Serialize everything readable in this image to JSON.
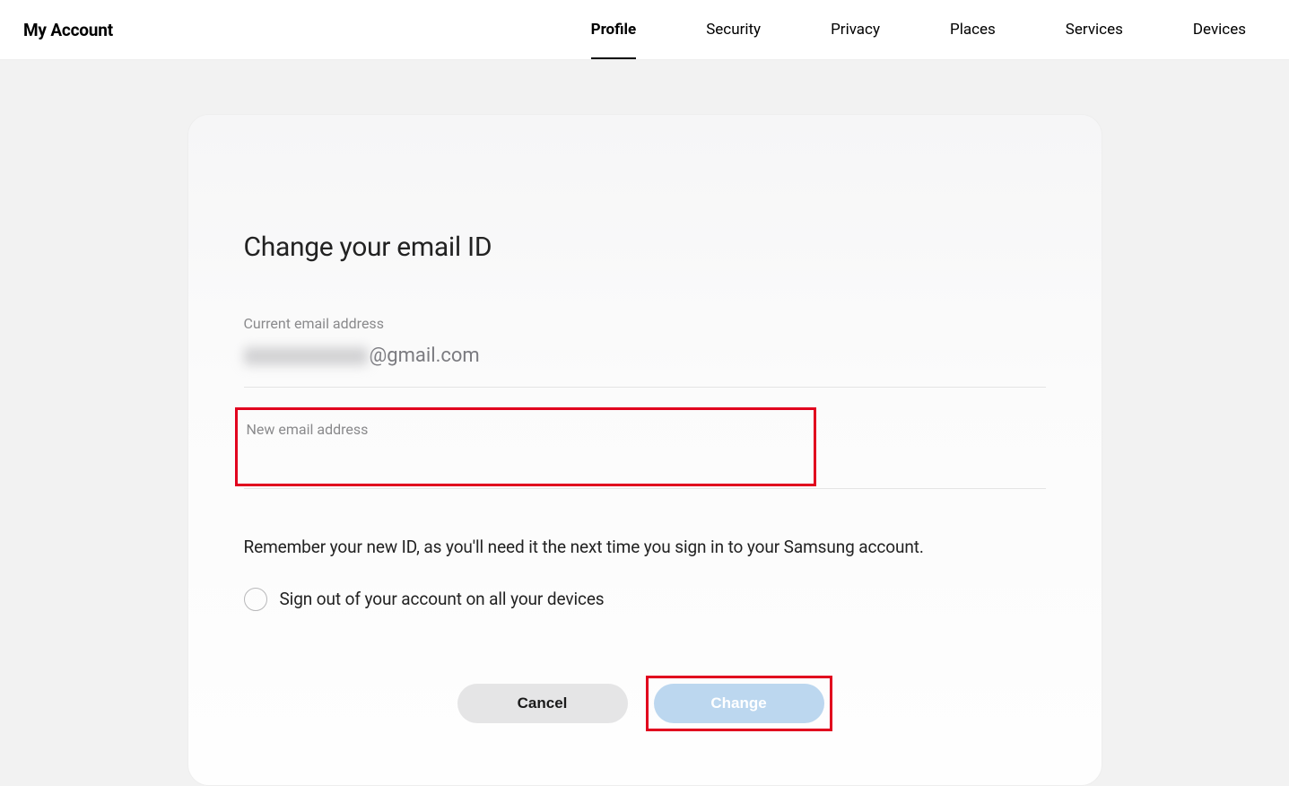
{
  "header": {
    "site_title": "My Account",
    "nav": [
      {
        "label": "Profile",
        "active": true
      },
      {
        "label": "Security",
        "active": false
      },
      {
        "label": "Privacy",
        "active": false
      },
      {
        "label": "Places",
        "active": false
      },
      {
        "label": "Services",
        "active": false
      },
      {
        "label": "Devices",
        "active": false
      }
    ]
  },
  "page": {
    "heading": "Change your email ID",
    "current_email_label": "Current email address",
    "current_email_domain": "@gmail.com",
    "new_email_label": "New email address",
    "new_email_value": "",
    "helper_text": "Remember your new ID, as you'll need it the next time you sign in to your Samsung account.",
    "signout_checkbox_label": "Sign out of your account on all your devices",
    "signout_checked": false,
    "buttons": {
      "cancel": "Cancel",
      "change": "Change"
    }
  }
}
